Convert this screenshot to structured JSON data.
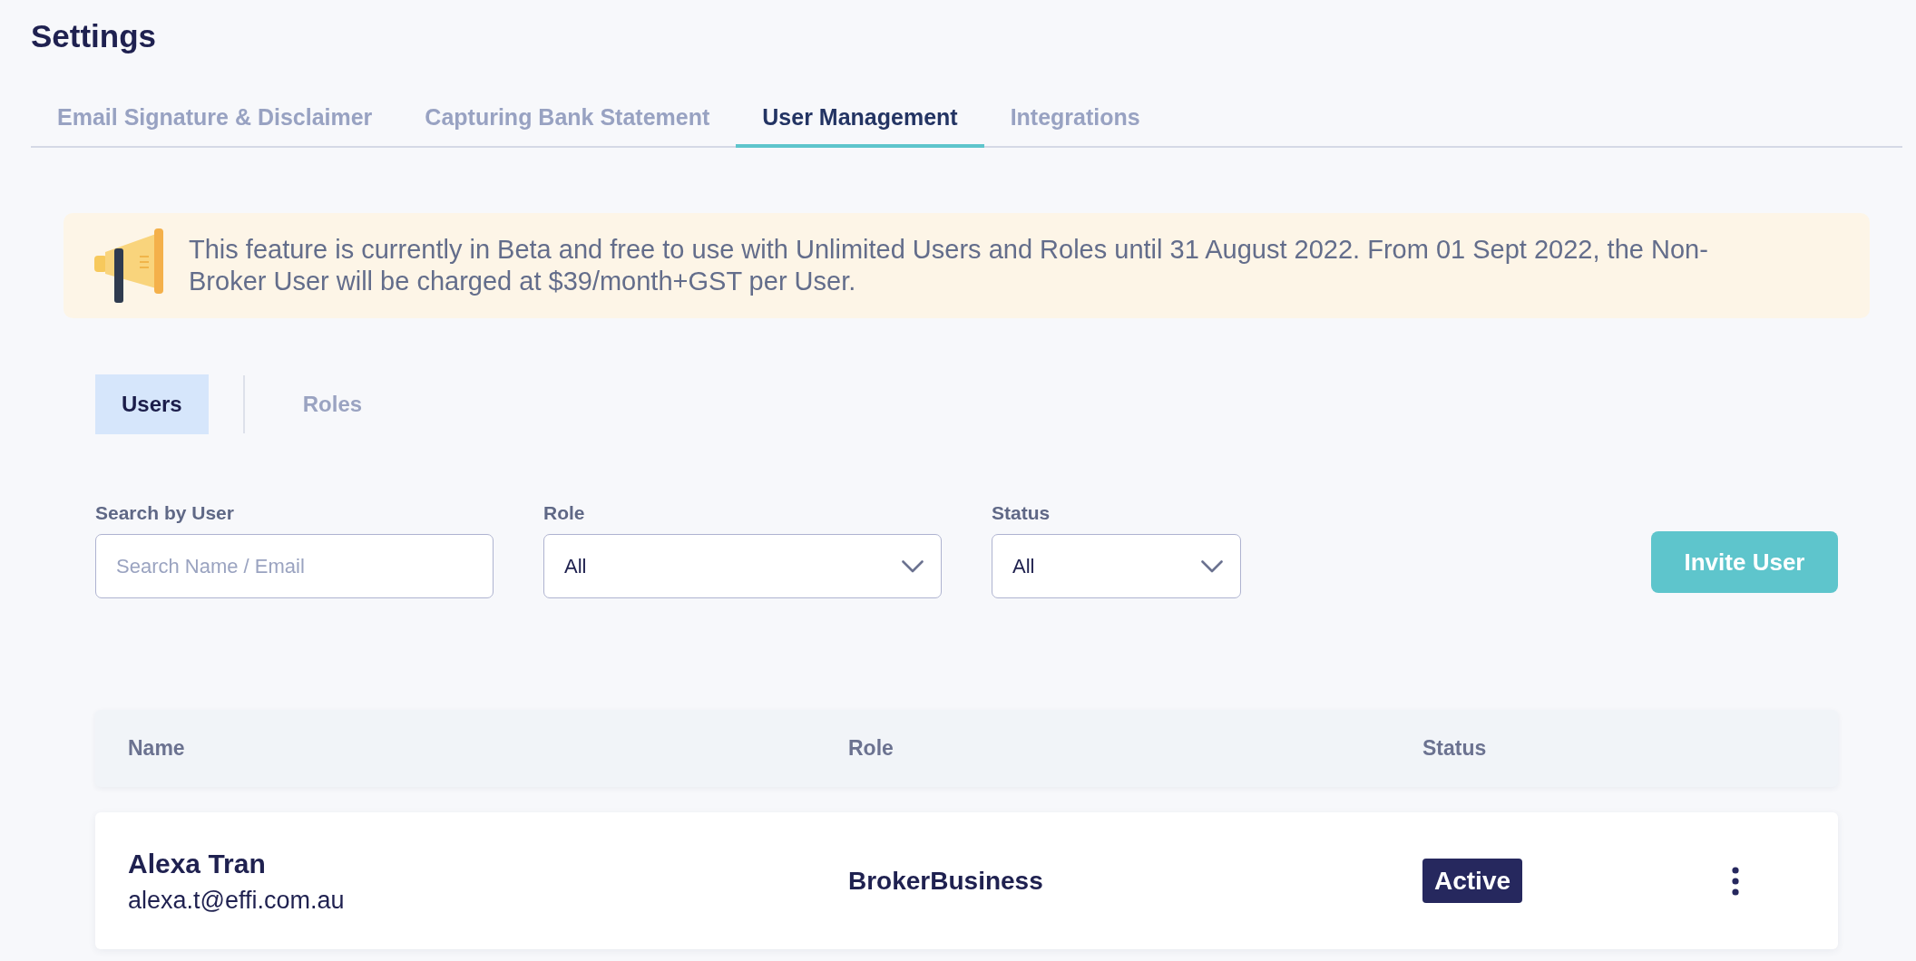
{
  "page": {
    "title": "Settings"
  },
  "tabs": [
    {
      "label": "Email Signature & Disclaimer",
      "selected": false
    },
    {
      "label": "Capturing Bank Statement",
      "selected": false
    },
    {
      "label": "User Management",
      "selected": true
    },
    {
      "label": "Integrations",
      "selected": false
    }
  ],
  "notice": {
    "lines": [
      "This feature is currently in Beta and free to use with Unlimited Users and Roles until 31 August 2022. From 01 Sept 2022, the Non-",
      "Broker User will be charged at $39/month+GST per User."
    ]
  },
  "sub_tabs": [
    {
      "label": "Users",
      "selected": true
    },
    {
      "label": "Roles",
      "selected": false
    }
  ],
  "filters": [
    {
      "kind": "search",
      "label": "Search by User",
      "placeholder": "Search Name / Email"
    },
    {
      "kind": "select",
      "label": "Role",
      "value": "All"
    },
    {
      "kind": "select",
      "label": "Status",
      "value": "All"
    }
  ],
  "invite_button": "Invite User",
  "table": {
    "columns": [
      "Name",
      "Role",
      "Status"
    ],
    "rows": [
      {
        "name": "Alexa Tran",
        "email": "alexa.t@effi.com.au",
        "role": "BrokerBusiness",
        "status": "Active"
      }
    ]
  }
}
